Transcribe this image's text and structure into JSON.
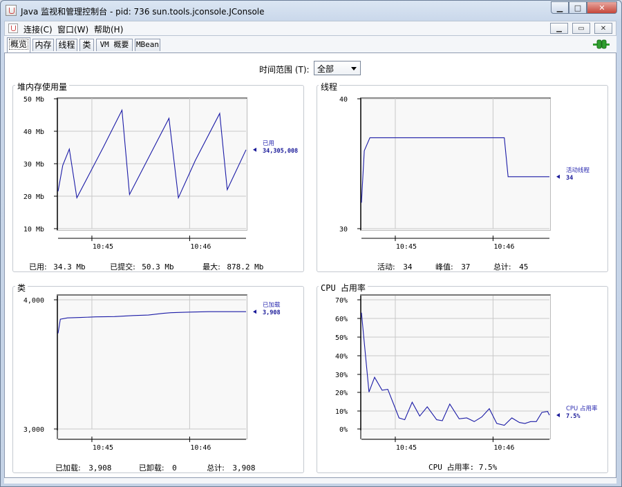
{
  "window": {
    "title": "Java 监视和管理控制台 - pid: 736 sun.tools.jconsole.JConsole",
    "btn_min": "▁",
    "btn_max": "□",
    "btn_close": "✕"
  },
  "menu": {
    "items": [
      "连接(C)",
      "窗口(W)",
      "帮助(H)"
    ],
    "inner_btns": [
      "▁",
      "▭",
      "✕"
    ]
  },
  "tabs": [
    "概览",
    "内存",
    "线程",
    "类",
    "VM 概要",
    "MBean"
  ],
  "active_tab": 0,
  "time_range": {
    "label": "时间范围 (T):",
    "value": "全部"
  },
  "colors": {
    "line": "#1a1aa6",
    "grid": "#c8c8c8",
    "accent_green": "#2f9e2f"
  },
  "panels": {
    "heap": {
      "title": "堆内存使用量",
      "stats": [
        {
          "label": "已用:",
          "value": "34.3  Mb"
        },
        {
          "label": "已提交:",
          "value": "50.3  Mb"
        },
        {
          "label": "最大:",
          "value": "878.2  Mb"
        }
      ],
      "marker_label": "已用",
      "marker_value": "34,305,008"
    },
    "threads": {
      "title": "线程",
      "stats": [
        {
          "label": "活动:",
          "value": "34"
        },
        {
          "label": "峰值:",
          "value": "37"
        },
        {
          "label": "总计:",
          "value": "45"
        }
      ],
      "marker_label": "活动线程",
      "marker_value": "34"
    },
    "classes": {
      "title": "类",
      "stats": [
        {
          "label": "已加载:",
          "value": "3,908"
        },
        {
          "label": "已卸载:",
          "value": "0"
        },
        {
          "label": "总计:",
          "value": "3,908"
        }
      ],
      "marker_label": "已加载",
      "marker_value": "3,908"
    },
    "cpu": {
      "title": "CPU 占用率",
      "stats_text": "CPU 占用率: 7.5%",
      "marker_label": "CPU 占用率",
      "marker_value": "7.5%"
    }
  },
  "chart_data": [
    {
      "type": "line",
      "id": "heap",
      "title": "堆内存使用量",
      "y_ticks": [
        "10 Mb",
        "20 Mb",
        "30 Mb",
        "40 Mb",
        "50 Mb"
      ],
      "ylim": [
        10,
        50
      ],
      "x_ticks": [
        "10:45",
        "10:46"
      ],
      "x_tick_pos": [
        0.18,
        0.7
      ],
      "grid": true,
      "x": [
        0,
        0.025,
        0.06,
        0.1,
        0.24,
        0.34,
        0.38,
        0.59,
        0.64,
        0.73,
        0.86,
        0.9,
        1.0
      ],
      "values": [
        21.5,
        29.5,
        34.5,
        19.5,
        35,
        46.5,
        20.5,
        44,
        19.5,
        31,
        45.5,
        22,
        34.3
      ]
    },
    {
      "type": "line",
      "id": "threads",
      "title": "线程",
      "y_ticks": [
        "30",
        "40"
      ],
      "ylim": [
        30,
        40
      ],
      "x_ticks": [
        "10:45",
        "10:46"
      ],
      "x_tick_pos": [
        0.18,
        0.7
      ],
      "grid": true,
      "x": [
        0,
        0.015,
        0.045,
        0.76,
        0.78,
        1.0
      ],
      "values": [
        32,
        36,
        37,
        37,
        34,
        34
      ]
    },
    {
      "type": "line",
      "id": "classes",
      "title": "类",
      "y_ticks": [
        "3,000",
        "4,000"
      ],
      "ylim": [
        3000,
        4000
      ],
      "x_ticks": [
        "10:45",
        "10:46"
      ],
      "x_tick_pos": [
        0.18,
        0.7
      ],
      "grid": true,
      "x": [
        0,
        0.012,
        0.05,
        0.12,
        0.2,
        0.3,
        0.4,
        0.48,
        0.56,
        0.6,
        0.7,
        0.8,
        1.0
      ],
      "values": [
        3740,
        3850,
        3860,
        3863,
        3868,
        3870,
        3878,
        3882,
        3895,
        3900,
        3905,
        3908,
        3908
      ]
    },
    {
      "type": "line",
      "id": "cpu",
      "title": "CPU 占用率",
      "y_ticks": [
        "0%",
        "10%",
        "20%",
        "30%",
        "40%",
        "50%",
        "60%",
        "70%"
      ],
      "ylim": [
        0,
        70
      ],
      "x_ticks": [
        "10:45",
        "10:46"
      ],
      "x_tick_pos": [
        0.18,
        0.7
      ],
      "grid": true,
      "x": [
        0,
        0.04,
        0.07,
        0.11,
        0.14,
        0.2,
        0.23,
        0.27,
        0.31,
        0.35,
        0.4,
        0.43,
        0.47,
        0.52,
        0.56,
        0.6,
        0.64,
        0.68,
        0.72,
        0.76,
        0.8,
        0.84,
        0.87,
        0.9,
        0.93,
        0.96,
        0.99,
        1.0
      ],
      "values": [
        63,
        20,
        28,
        21,
        21.5,
        6,
        5,
        14.5,
        7,
        12,
        5,
        4.5,
        13.5,
        5.5,
        6,
        4,
        6.5,
        11,
        3,
        2,
        6,
        3.5,
        3,
        4,
        4,
        9,
        9.5,
        7.5
      ]
    }
  ]
}
